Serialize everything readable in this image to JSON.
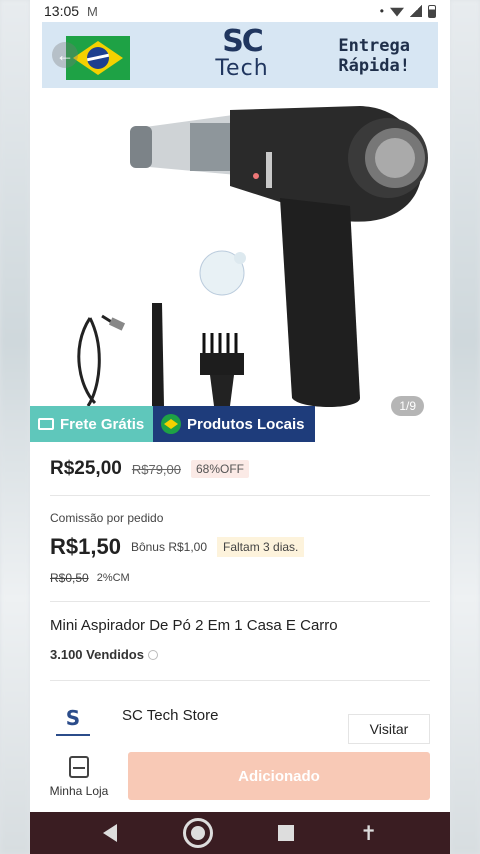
{
  "status_bar": {
    "time": "13:05",
    "mail_icon": "M"
  },
  "banner": {
    "logo_sc": "SC",
    "logo_tech": "Tech",
    "tagline_line1": "Entrega",
    "tagline_line2": "Rápida!"
  },
  "gallery": {
    "page_indicator": "1/9"
  },
  "badges": {
    "frete": "Frete Grátis",
    "local": "Produtos Locais"
  },
  "pricing": {
    "price": "R$25,00",
    "old_price": "R$79,00",
    "discount": "68%OFF"
  },
  "commission": {
    "label": "Comissão por pedido",
    "value": "R$1,50",
    "bonus": "Bônus R$1,00",
    "days_left": "Faltam 3 dias.",
    "old_value": "R$0,50",
    "rate": "2%CM"
  },
  "product": {
    "title": "Mini Aspirador De Pó 2 Em 1 Casa E Carro",
    "sold": "3.100 Vendidos"
  },
  "store": {
    "name": "SC Tech Store",
    "visit_label": "Visitar"
  },
  "action_bar": {
    "my_store_label": "Minha Loja",
    "add_label": "Adicionado"
  },
  "colors": {
    "frete_badge": "#5fc7bb",
    "local_badge": "#1e3c7b",
    "add_button": "#f8c9b6",
    "nav_bar": "#3a1d22",
    "banner_bg": "#d7e6f3"
  }
}
